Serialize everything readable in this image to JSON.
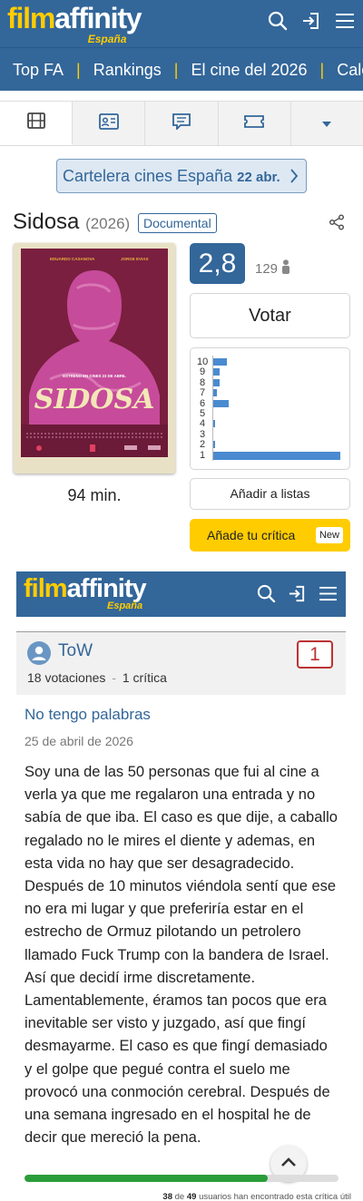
{
  "header": {
    "logo_main": "film",
    "logo_accent": "affinity",
    "logo_region": "España"
  },
  "nav": {
    "items": [
      "Top FA",
      "Rankings",
      "El cine del 2026",
      "Calenda"
    ]
  },
  "tabs": {
    "icons": [
      "film-icon",
      "cast-card-icon",
      "reviews-icon",
      "ticket-icon",
      "dropdown-icon"
    ]
  },
  "cartelera": {
    "label": "Cartelera cines España",
    "date": "22 abr."
  },
  "movie": {
    "title": "Sidosa",
    "year": "(2026)",
    "genre": "Documental",
    "runtime": "94 min.",
    "rating": "2,8",
    "votes": "129",
    "vote_label": "Votar",
    "lists_label": "Añadir a listas",
    "review_label": "Añade tu crítica",
    "new_badge": "New",
    "poster_text": {
      "actor_left": "EDUARDO CASANOVA",
      "actor_right": "JORGE EVIAS",
      "release": "ESTRENO EN CINES 23 DE ABRIL",
      "title_art": "SIDOSA"
    }
  },
  "chart_data": {
    "type": "bar",
    "orientation": "horizontal",
    "categories": [
      "10",
      "9",
      "8",
      "7",
      "6",
      "5",
      "4",
      "3",
      "2",
      "1"
    ],
    "values": [
      8,
      4,
      4,
      2,
      9,
      0,
      1,
      0,
      1,
      76
    ],
    "xlabel": "",
    "ylabel": "",
    "grid": false,
    "color": "#4a8ad0"
  },
  "review": {
    "user": "ToW",
    "votaciones": "18 votaciones",
    "separator": "-",
    "criticas": "1 crítica",
    "score": "1",
    "title": "No tengo palabras",
    "date": "25 de abril de 2026",
    "paragraphs": [
      "Soy una de las 50 personas que fui al cine a verla ya que me regalaron una entrada y no sabía de que iba. El caso es que dije, a caballo regalado no le mires el diente y ademas, en esta vida no hay que ser desagradecido.",
      "Después de 10 minutos viéndola sentí que ese no era mi lugar y que preferiría estar en el estrecho de Ormuz pilotando un petrolero llamado Fuck Trump con la bandera de Israel. Así que decidí irme discretamente. Lamentablemente, éramos tan pocos que era inevitable ser visto y juzgado, así que fingí desmayarme. El caso es que fingí demasiado y el golpe que pegué contra el suelo me provocó una conmoción cerebral. Después de una semana ingresado en el hospital he de decir que mereció la pena."
    ],
    "useful_count": "38",
    "useful_of": "de",
    "useful_total": "49",
    "useful_text": "usuarios han encontrado esta crítica útil",
    "useful_fraction": 0.776
  },
  "colors": {
    "brand_blue": "#336699",
    "brand_yellow": "#ffcc00",
    "useful_green": "#2a9d3a",
    "score_red": "#bb3333"
  }
}
